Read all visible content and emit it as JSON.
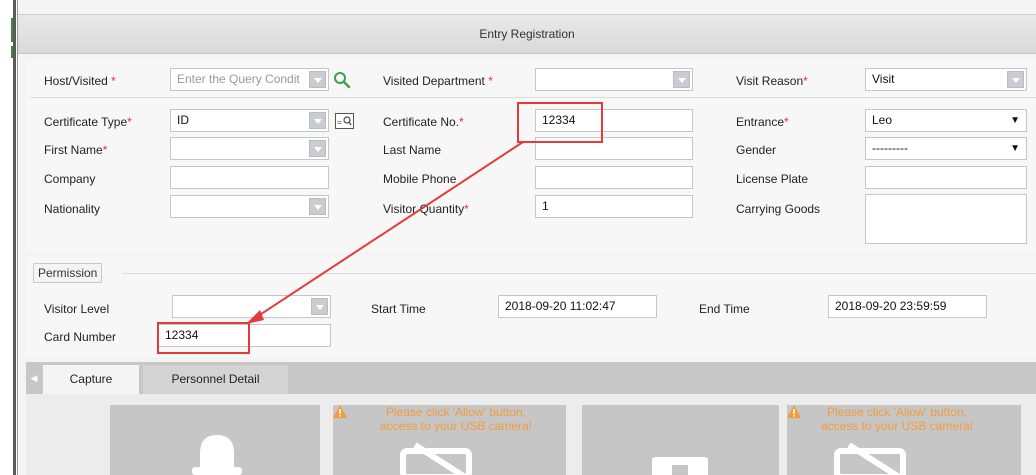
{
  "dialog": {
    "title": "Entry Registration"
  },
  "form": {
    "host_visited": {
      "label": "Host/Visited",
      "placeholder": "Enter the Query Condit"
    },
    "visited_department": {
      "label": "Visited Department",
      "value": ""
    },
    "visit_reason": {
      "label": "Visit Reason",
      "value": "Visit"
    },
    "certificate_type": {
      "label": "Certificate Type",
      "value": "ID"
    },
    "certificate_no": {
      "label": "Certificate No.",
      "value": "12334"
    },
    "entrance": {
      "label": "Entrance",
      "value": "Leo"
    },
    "first_name": {
      "label": "First Name",
      "value": ""
    },
    "last_name": {
      "label": "Last Name",
      "value": ""
    },
    "gender": {
      "label": "Gender",
      "value": "---------"
    },
    "company": {
      "label": "Company",
      "value": ""
    },
    "mobile_phone": {
      "label": "Mobile Phone",
      "value": ""
    },
    "license_plate": {
      "label": "License Plate",
      "value": ""
    },
    "nationality": {
      "label": "Nationality",
      "value": ""
    },
    "visitor_quantity": {
      "label": "Visitor Quantity",
      "value": "1"
    },
    "carrying_goods": {
      "label": "Carrying Goods",
      "value": ""
    },
    "required_mark": "*"
  },
  "permission": {
    "legend": "Permission",
    "visitor_level": {
      "label": "Visitor Level",
      "value": ""
    },
    "start_time": {
      "label": "Start Time",
      "value": "2018-09-20 11:02:47"
    },
    "end_time": {
      "label": "End Time",
      "value": "2018-09-20 23:59:59"
    },
    "card_number": {
      "label": "Card Number",
      "value": "12334"
    }
  },
  "tabs": {
    "capture": "Capture",
    "personnel_detail": "Personnel Detail"
  },
  "capture": {
    "camera_warning": "Please click 'Allow' button, access to your USB camera!"
  },
  "icons": {
    "search": "search-icon",
    "id_card_reader": "id-card-icon",
    "warning": "warning-icon",
    "camera_off": "camera-off-icon",
    "person": "person-silhouette-icon"
  },
  "colors": {
    "required": "#dd3333",
    "highlight": "#e33b3b",
    "warning": "#f39c3d",
    "search_icon": "#3aa04a"
  }
}
